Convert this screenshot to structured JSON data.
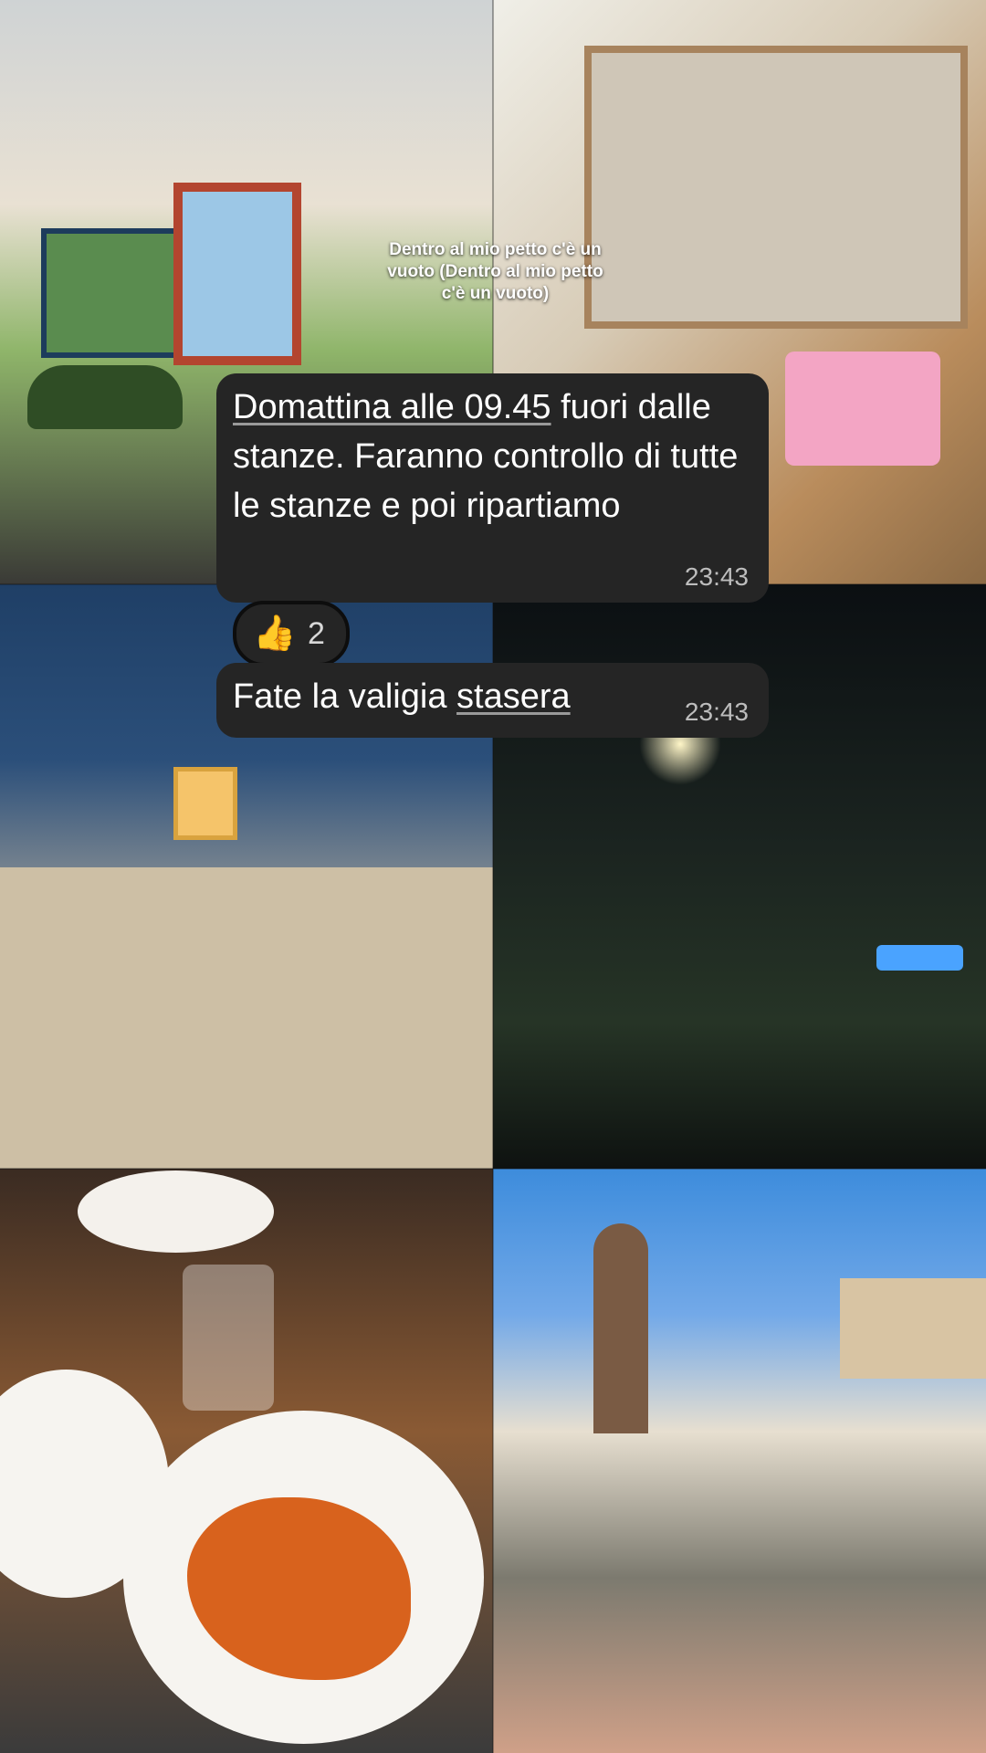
{
  "story": {
    "caption": "Dentro al mio petto c'è un vuoto (Dentro al mio petto c'è un vuoto)"
  },
  "chat": {
    "message1": {
      "part1": "Domattina alle 09.45",
      "part2": " fuori dalle stanze. Faranno controllo di tutte le stanze e poi ripartiamo",
      "time": "23:43"
    },
    "reaction": {
      "icon": "thumbs-up-icon",
      "emoji": "👍",
      "count": "2"
    },
    "message2": {
      "part1": "Fate la valigia ",
      "part2": "stasera",
      "time": "23:43"
    }
  },
  "colors": {
    "bubble": "#252525",
    "timestamp": "#bdbdbd"
  }
}
